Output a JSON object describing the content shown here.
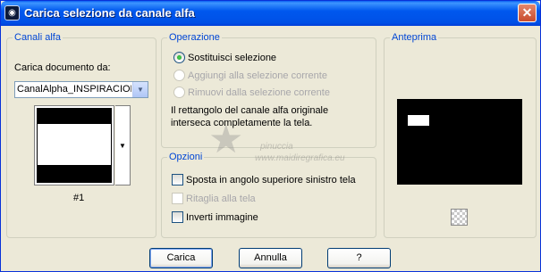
{
  "window": {
    "title": "Carica selezione da canale alfa"
  },
  "canali_alfa": {
    "legend": "Canali alfa",
    "load_label": "Carica documento da:",
    "document_value": "CanalAlpha_INSPIRACION",
    "channel_label": "#1"
  },
  "operazione": {
    "legend": "Operazione",
    "options": [
      {
        "label": "Sostituisci selezione",
        "checked": true,
        "enabled": true
      },
      {
        "label": "Aggiungi alla selezione corrente",
        "checked": false,
        "enabled": false
      },
      {
        "label": "Rimuovi dalla selezione corrente",
        "checked": false,
        "enabled": false
      }
    ],
    "message": [
      "Il rettangolo del canale alfa originale",
      "interseca completamente la tela."
    ]
  },
  "opzioni": {
    "legend": "Opzioni",
    "options": [
      {
        "label": "Sposta in angolo superiore sinistro tela",
        "checked": false,
        "enabled": true
      },
      {
        "label": "Ritaglia alla tela",
        "checked": false,
        "enabled": false
      },
      {
        "label": "Inverti immagine",
        "checked": false,
        "enabled": true
      }
    ]
  },
  "anteprima": {
    "legend": "Anteprima"
  },
  "watermark": {
    "line1": "pinuccia",
    "line2": "www.maidiregrafica.eu"
  },
  "buttons": {
    "load": "Carica",
    "cancel": "Annulla",
    "help": "?"
  },
  "colors": {
    "accent": "#0046D5",
    "title_bar": "#0058EE",
    "dialog_bg": "#ECE9D8"
  }
}
